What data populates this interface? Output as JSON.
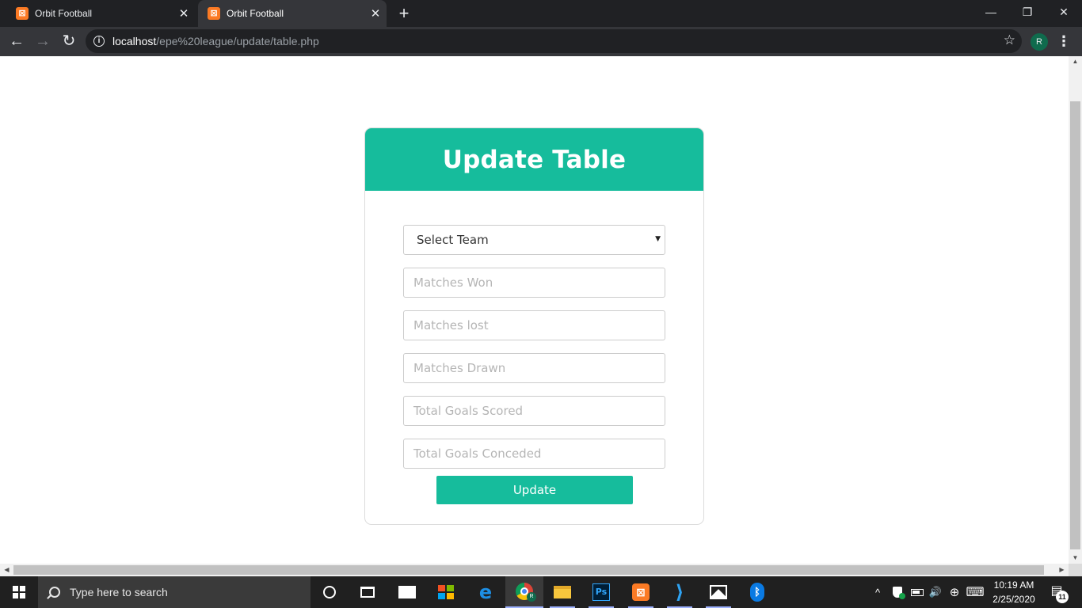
{
  "browser": {
    "tabs": [
      {
        "title": "Orbit Football",
        "close": "✕",
        "favicon": "xampp-icon"
      },
      {
        "title": "Orbit Football",
        "close": "✕",
        "favicon": "xampp-icon"
      }
    ],
    "new_tab": "+",
    "window_controls": {
      "minimize": "—",
      "restore": "❐",
      "close": "✕"
    },
    "nav": {
      "back": "←",
      "forward": "→",
      "reload": "↻"
    },
    "url_host": "localhost",
    "url_path": "/epe%20league/update/table.php",
    "bookmark_star": "☆",
    "profile_initial": "R",
    "menu": "⋮"
  },
  "form": {
    "title": "Update Table",
    "select_team": {
      "selected": "Select Team",
      "caret": "▼"
    },
    "fields": {
      "matches_won": "Matches Won",
      "matches_lost": "Matches lost",
      "matches_drawn": "Matches Drawn",
      "goals_scored": "Total Goals Scored",
      "goals_conceded": "Total Goals Conceded"
    },
    "submit_label": "Update",
    "accent_color": "#16bc9c"
  },
  "taskbar": {
    "search_placeholder": "Type here to search",
    "chrome_badge": "R",
    "ps_label": "Ps",
    "xampp_label": "⊠",
    "vscode_label": "⟩",
    "bluetooth_label": "ᛒ",
    "tray": {
      "chevron": "^",
      "volume": "🔊",
      "language": "⊕",
      "keyboard": "⌨"
    },
    "time": "10:19 AM",
    "date": "2/25/2020",
    "notification_count": "11"
  }
}
